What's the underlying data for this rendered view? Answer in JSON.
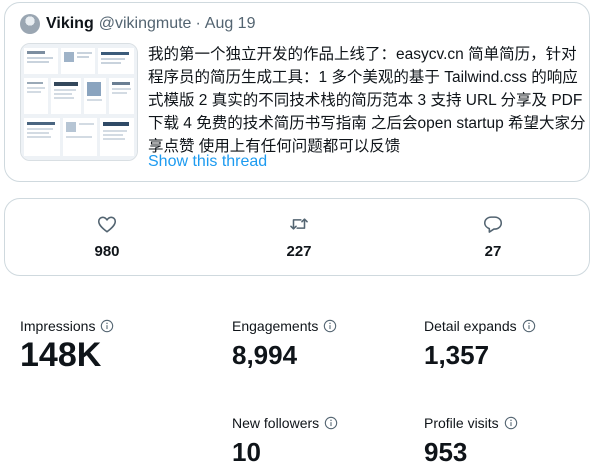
{
  "tweet": {
    "author_name": "Viking",
    "author_handle": "@vikingmute",
    "separator": "·",
    "date": "Aug 19",
    "text": "我的第一个独立开发的作品上线了：easycv.cn 简单简历，针对程序员的简历生成工具：1 多个美观的基于 Tailwind.css 的响应式模版 2 真实的不同技术栈的简历范本 3 支持 URL 分享及 PDF 下载 4 免费的技术简历书写指南 之后会open startup 希望大家分享点赞 使用上有任何问题都可以反馈",
    "show_thread": "Show this thread",
    "avatar_icon": "user-avatar",
    "thumbnail_icon": "website-screenshot"
  },
  "engagement": {
    "likes": {
      "icon": "heart-icon",
      "count": "980"
    },
    "retweets": {
      "icon": "retweet-icon",
      "count": "227"
    },
    "replies": {
      "icon": "reply-icon",
      "count": "27"
    }
  },
  "stats": {
    "impressions": {
      "label": "Impressions",
      "value": "148K"
    },
    "engagements": {
      "label": "Engagements",
      "value": "8,994"
    },
    "detail_expands": {
      "label": "Detail expands",
      "value": "1,357"
    },
    "new_followers": {
      "label": "New followers",
      "value": "10"
    },
    "profile_visits": {
      "label": "Profile visits",
      "value": "953"
    }
  },
  "colors": {
    "link": "#1d9bf0",
    "secondary_text": "#536471",
    "border": "#cfd9de",
    "primary_text": "#0f1419"
  }
}
